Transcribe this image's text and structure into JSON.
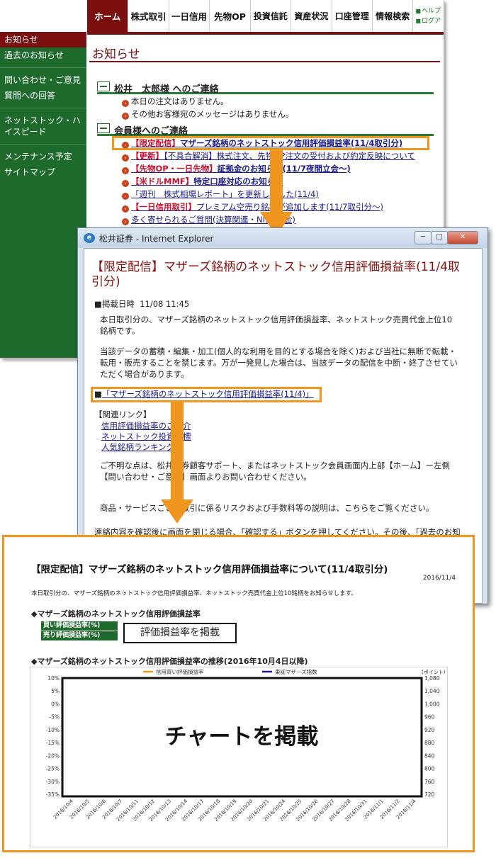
{
  "portal": {
    "nav_tabs": [
      "ホーム",
      "株式取引",
      "一日信用",
      "先物OP",
      "投資信託",
      "資産状況",
      "口座管理",
      "情報検索"
    ],
    "nav_mini": [
      "ヘルプ",
      "ログア"
    ],
    "sidebar": [
      "お知らせ",
      "過去のお知らせ",
      "問い合わせ・ご意見",
      "質問への回答",
      "ネットストック・ハイスピード",
      "メンテナンス予定",
      "サイトマップ"
    ],
    "page_title": "お知らせ",
    "section1": "松井　太郎様 へのご連絡",
    "section1_items": [
      "本日の注文はありません。",
      "その他お客様宛のメッセージはありません。"
    ],
    "section2": "会員様へのご連絡",
    "news": [
      {
        "tag": "【限定配信】",
        "text": "マザーズ銘柄のネットストック信用評価損益率(11/4取引分)"
      },
      {
        "tag": "【更新】",
        "text": "【不具合解消】株式注文、先物OP注文の受付および約定反映について"
      },
      {
        "tag": "【先物OP・一日先物】",
        "text": "証拠金のお知らせ(11/7夜間立会〜)"
      },
      {
        "tag": "【米ドルMMF】",
        "text": "特定口座対応のお知らせ"
      },
      {
        "tag": "",
        "text": "「週刊　株式相場レポート」を更新しました(11/4)"
      },
      {
        "tag": "【一日信用取引】",
        "text": "プレミアム空売り銘柄が追加します(11/7取引分〜)"
      },
      {
        "tag": "",
        "text": "多く寄せられるご質問(決算関連・NISA入金)"
      }
    ]
  },
  "ie": {
    "window_title": "松井証券 - Internet Explorer",
    "btn_min": "─",
    "btn_max": "□",
    "btn_close": "✕",
    "heading": "【限定配信】マザーズ銘柄のネットストック信用評価損益率(11/4取引分)",
    "posted_label": "■掲載日時",
    "posted_value": "11/08 11:45",
    "para1": "本日取引分の、マザーズ銘柄のネットストック信用評価損益率、ネットストック売買代金上位10銘柄です。",
    "para2": "当該データの蓄積・編集・加工(個人的な利用を目的とする場合を除く)および当社に無断で転載・転用・販売することを禁じます。万が一発見した場合は、当該データの配信を中断・終了させていただく場合があります。",
    "doc_link_prefix": "■",
    "doc_link": "「マザーズ銘柄のネットストック信用評価損益率(11/4)」",
    "related_label": "【関連リンク】",
    "related": [
      "信用評価損益率のご紹介",
      "ネットストック投資指標",
      "人気銘柄ランキング"
    ],
    "contact_text": "ご不明な点は、松井証券顧客サポート、またはネットストック会員画面内上部【ホーム】ー左側【問い合わせ・ご意見】画面よりお問い合わせください。",
    "risk_text": "商品・サービスごとの取引に係るリスクおよび手数料等の説明は、こちらをご覧ください。",
    "confirm_text": "連絡内容を確認後に画面を閉じる場合、「確認する」ボタンを押してください。その後、「過去のお知"
  },
  "pdf": {
    "title": "【限定配信】マザーズ銘柄のネットストック信用評価損益率について(11/4取引分)",
    "date": "2016/11/4",
    "description": "本日取引分の、マザーズ銘柄のネットストック信用評価損益率、ネットストック売買代金上位10銘柄をお知らせします。",
    "section1": "◆マザーズ銘柄のネットストック信用評価損益率",
    "legend_rows": [
      "買い評価損益率(%)",
      "売り評価損益率(%)"
    ],
    "table_placeholder": "評価損益率を掲載",
    "section2": "◆マザーズ銘柄のネットストック信用評価損益率の推移(2016年10月4日以降)",
    "chart_placeholder": "チャートを掲載"
  },
  "chart_data": {
    "type": "line",
    "legend": [
      "信用買い評価損益率",
      "東証マザーズ指数"
    ],
    "legend_colors": [
      "#f0961e",
      "#1a1a8c"
    ],
    "y_left_ticks": [
      "10%",
      "5%",
      "0%",
      "-5%",
      "-10%",
      "-15%",
      "-20%",
      "-25%",
      "-30%",
      "-35%"
    ],
    "y_right_unit": "(ポイント)",
    "y_right_ticks": [
      "1,080",
      "1,040",
      "1,000",
      "960",
      "920",
      "880",
      "840",
      "800",
      "760",
      "720"
    ],
    "ylim_left": [
      -35,
      10
    ],
    "ylim_right": [
      720,
      1080
    ],
    "x_categories": [
      "2016/10/4",
      "2016/10/5",
      "2016/10/6",
      "2016/10/7",
      "2016/10/11",
      "2016/10/12",
      "2016/10/13",
      "2016/10/14",
      "2016/10/17",
      "2016/10/18",
      "2016/10/19",
      "2016/10/20",
      "2016/10/21",
      "2016/10/24",
      "2016/10/25",
      "2016/10/26",
      "2016/10/27",
      "2016/10/28",
      "2016/10/31",
      "2016/11/1",
      "2016/11/2",
      "2016/11/4"
    ],
    "series": []
  }
}
